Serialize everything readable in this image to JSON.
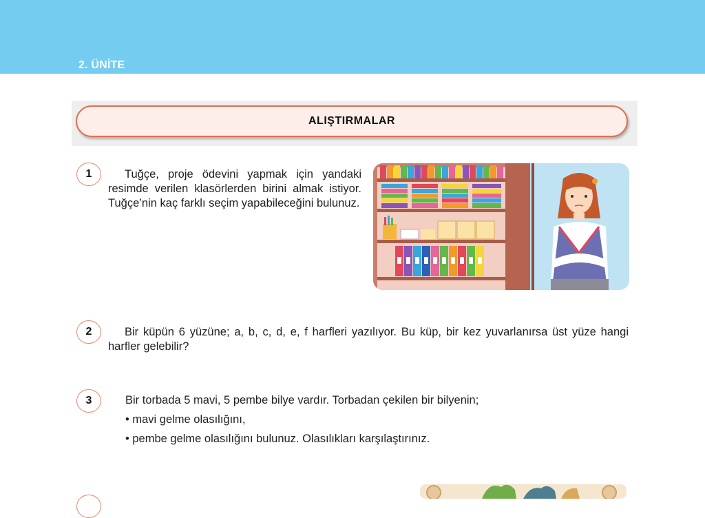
{
  "header": {
    "unit": "2. ÜNİTE"
  },
  "section": {
    "title": "ALIŞTIRMALAR"
  },
  "questions": [
    {
      "number": "1",
      "text": "Tuğçe, proje ödevini yapmak için yandaki resimde verilen klasörlerden birini almak istiyor. Tuğçe’nin kaç farklı seçim yapabileceğini bulunuz."
    },
    {
      "number": "2",
      "text": "Bir küpün 6 yüzüne; a, b, c, d, e, f harfleri yazılıyor. Bu küp, bir kez yuvarlanırsa üst yüze hangi harfler gelebilir?"
    },
    {
      "number": "3",
      "text": "Bir torbada 5 mavi, 5 pembe bilye vardır. Torbadan çekilen bir bilyenin;",
      "bullets": [
        "• mavi gelme olasılığını,",
        "• pembe gelme olasılığını bulunuz. Olasılıkları karşılaştırınız."
      ]
    }
  ],
  "colors": {
    "header_band": "#74cdf1",
    "title_border": "#e06f4f",
    "title_fill": "#fdeeea",
    "number_circle": "#e8836b"
  }
}
